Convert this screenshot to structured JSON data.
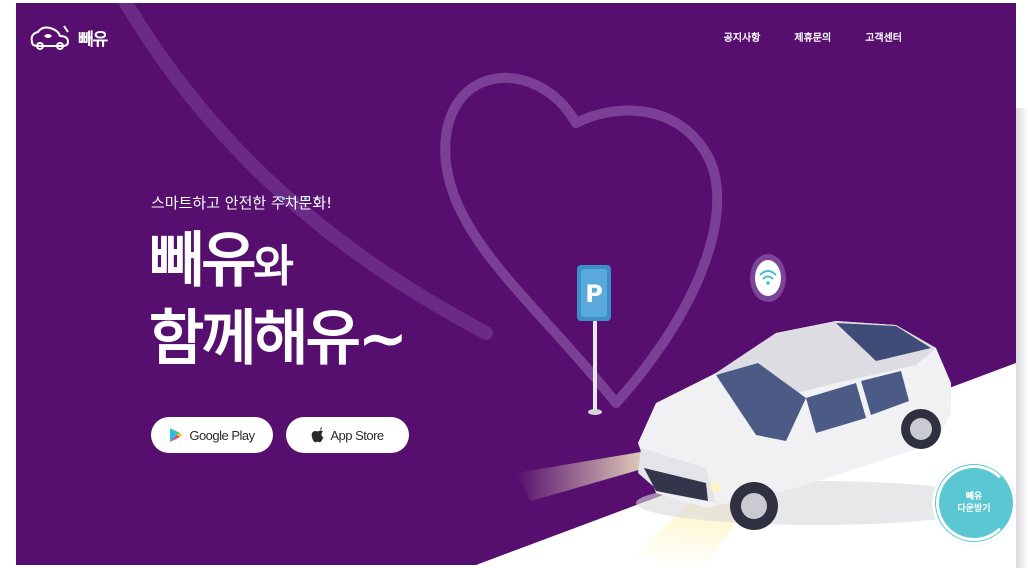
{
  "header": {
    "logo_text": "빼유",
    "nav": [
      "공지사항",
      "제휴문의",
      "고객센터"
    ]
  },
  "hero": {
    "subtitle": "스마트하고 안전한 주차문화!",
    "headline_brand": "빼유",
    "headline_particle": "와",
    "headline_line2": "함께해유~",
    "google_play_label": "Google Play",
    "app_store_label": "App Store"
  },
  "download_badge": {
    "line1": "빼유",
    "line2": "다운받기"
  },
  "illustration": {
    "parking_sign": "P"
  },
  "colors": {
    "background": "#560f6e",
    "accent": "#5ac7d3",
    "road": "#ffffff"
  },
  "icons": [
    "car-logo-icon",
    "google-play-icon",
    "apple-icon",
    "wifi-icon",
    "parking-sign-icon"
  ]
}
